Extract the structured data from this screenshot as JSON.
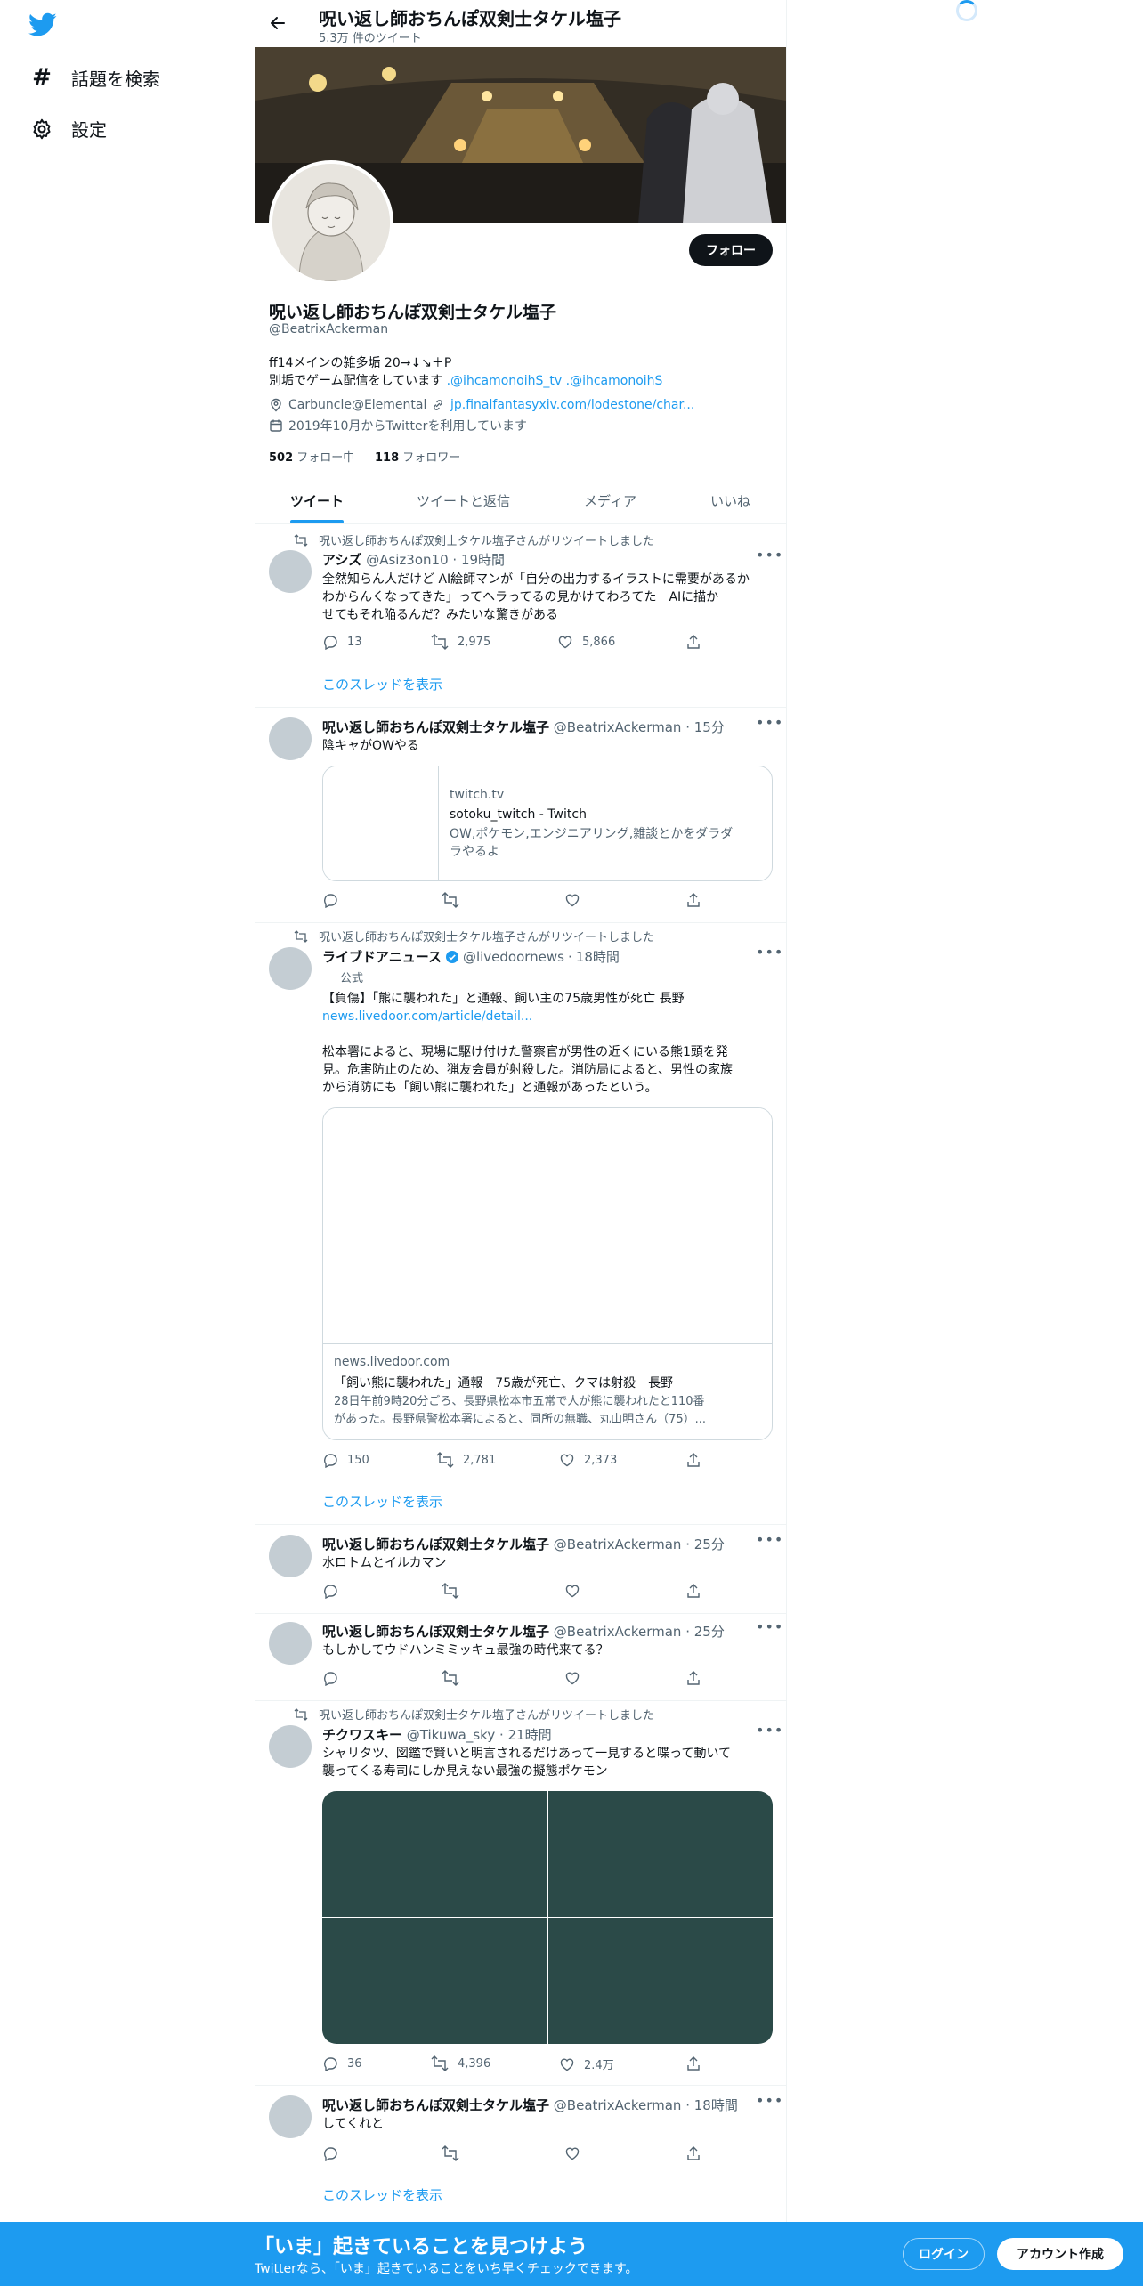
{
  "nav": {
    "search_label": "話題を検索",
    "settings_label": "設定"
  },
  "header": {
    "title": "呪い返し師おちんぽ双剣士タケル塩子",
    "tweet_count": "5.3万 件のツイート"
  },
  "profile": {
    "follow_label": "フォロー",
    "name": "呪い返し師おちんぽ双剣士タケル塩子",
    "handle": "@BeatrixAckerman",
    "bio_line1": "ff14メインの雑多垢 20→↓↘＋P",
    "bio_line2_prefix": "別垢でゲーム配信をしています ",
    "bio_link1": ".@ihcamonoihS_tv",
    "bio_link2": ".@ihcamonoihS",
    "location": "Carbuncle@Elemental",
    "website": "jp.finalfantasyxiv.com/lodestone/char...",
    "joined": "2019年10月からTwitterを利用しています",
    "following_count": "502",
    "following_label": "フォロー中",
    "followers_count": "118",
    "followers_label": "フォロワー"
  },
  "tabs": [
    "ツイート",
    "ツイートと返信",
    "メディア",
    "いいね"
  ],
  "thread_label": "このスレッドを表示",
  "tweets": [
    {
      "retweet_note": "呪い返し師おちんぽ双剣士タケル塩子さんがリツイートしました",
      "name": "アシズ",
      "handle": "@Asiz3on10",
      "time": "19時間",
      "line1": "全然知らん人だけど AI絵師マンが「自分の出力するイラストに需要があるか",
      "line2": "わからんくなってきた」ってヘラってるの見かけてわろてた　AIに描か",
      "line3": "せてもそれ陥るんだ？みたいな驚きがある",
      "replies": "13",
      "retweets": "2,975",
      "likes": "5,866"
    },
    {
      "name": "呪い返し師おちんぽ双剣士タケル塩子",
      "handle": "@BeatrixAckerman",
      "time": "15分",
      "line1": "陰キャがOWやる",
      "card_domain": "twitch.tv",
      "card_title": "sotoku_twitch - Twitch",
      "card_desc1": "OW,ポケモン,エンジニアリング,雑談とかをダラダ",
      "card_desc2": "ラやるよ"
    },
    {
      "retweet_note": "呪い返し師おちんぽ双剣士タケル塩子さんがリツイートしました",
      "name": "ライブドアニュース",
      "handle": "@livedoornews",
      "time": "18時間",
      "badge": "公式",
      "line1": "【負傷】「熊に襲われた」と通報、飼い主の75歳男性が死亡 長野",
      "link": "news.livedoor.com/article/detail...",
      "line2": "松本署によると、現場に駆け付けた警察官が男性の近くにいる熊1頭を発",
      "line3": "見。危害防止のため、猟友会員が射殺した。消防局によると、男性の家族",
      "line4": "から消防にも「飼い熊に襲われた」と通報があったという。",
      "card_domain": "news.livedoor.com",
      "card_title": "「飼い熊に襲われた」通報　75歳が死亡、クマは射殺　長野",
      "card_desc1": "28日午前9時20分ごろ、長野県松本市五常で人が熊に襲われたと110番",
      "card_desc2": "があった。長野県警松本署によると、同所の無職、丸山明さん（75）...",
      "replies": "150",
      "retweets": "2,781",
      "likes": "2,373"
    },
    {
      "name": "呪い返し師おちんぽ双剣士タケル塩子",
      "handle": "@BeatrixAckerman",
      "time": "25分",
      "line1": "水ロトムとイルカマン"
    },
    {
      "name": "呪い返し師おちんぽ双剣士タケル塩子",
      "handle": "@BeatrixAckerman",
      "time": "25分",
      "line1": "もしかしてウドハンミミッキュ最強の時代来てる？"
    },
    {
      "retweet_note": "呪い返し師おちんぽ双剣士タケル塩子さんがリツイートしました",
      "name": "チクワスキー",
      "handle": "@Tikuwa_sky",
      "time": "21時間",
      "line1": "シャリタツ、図鑑で賢いと明言されるだけあって一見すると喋って動いて",
      "line2": "襲ってくる寿司にしか見えない最強の擬態ポケモン",
      "replies": "36",
      "retweets": "4,396",
      "likes": "2.4万"
    },
    {
      "name": "呪い返し師おちんぽ双剣士タケル塩子",
      "handle": "@BeatrixAckerman",
      "time": "18時間",
      "line1": "してくれと"
    }
  ],
  "bottom_bar": {
    "headline": "「いま」起きていることを見つけよう",
    "sub": "Twitterなら、「いま」起きていることをいち早くチェックできます。",
    "login_label": "ログイン",
    "signup_label": "アカウント作成"
  },
  "colors": {
    "accent": "#1d9bf0",
    "bottom_bar": "#1d9bf0",
    "media_tile": "#2b4a48"
  }
}
